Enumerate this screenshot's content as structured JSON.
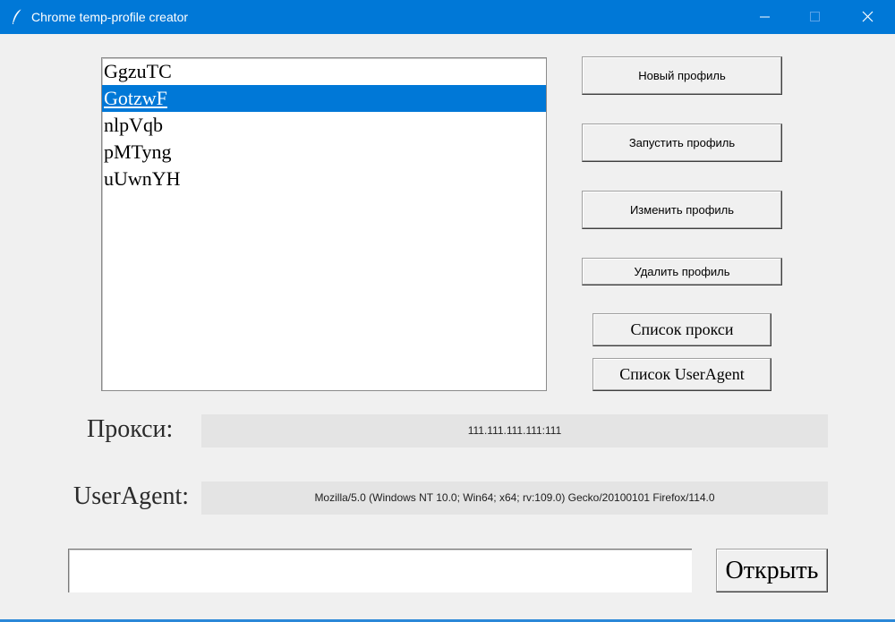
{
  "window": {
    "title": "Chrome temp-profile creator",
    "icon": "feather-icon",
    "controls": {
      "minimize_icon": "minimize-icon",
      "maximize_icon": "maximize-icon",
      "close_icon": "close-icon"
    },
    "accent_color": "#0078d7"
  },
  "profiles": {
    "items": [
      "GgzuTC",
      "GotzwF",
      "nlpVqb",
      "pMTyng",
      "uUwnYH"
    ],
    "selected": "GotzwF",
    "selection_color": "#0078d7"
  },
  "buttons": {
    "new_profile": "Новый профиль",
    "launch_profile": "Запустить профиль",
    "edit_profile": "Изменить профиль",
    "delete_profile": "Удалить профиль",
    "proxy_list": "Список прокси",
    "useragent_list": "Список UserAgent",
    "open": "Открыть"
  },
  "fields": {
    "proxy_label": "Прокси:",
    "proxy_value": "111.111.111.111:111",
    "useragent_label": "UserAgent:",
    "useragent_value": "Mozilla/5.0 (Windows NT 10.0; Win64; x64; rv:109.0) Gecko/20100101 Firefox/114.0",
    "path_value": ""
  }
}
